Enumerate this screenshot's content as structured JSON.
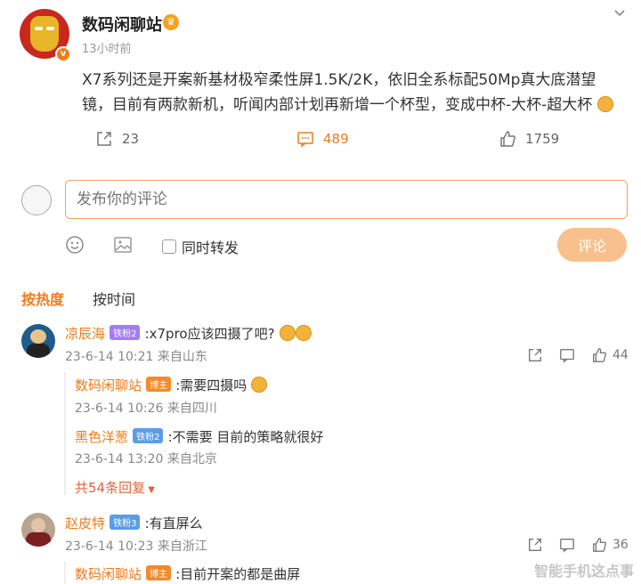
{
  "post": {
    "author": "数码闲聊站",
    "time": "13小时前",
    "text": "X7系列还是开案新基材极窄柔性屏1.5K/2K，依旧全系标配50Mp真大底潜望镜，目前有两款新机，听闻内部计划再新增一个杯型，变成中杯-大杯-超大杯",
    "verify_mark": "v",
    "shares": "23",
    "comments": "489",
    "likes": "1759"
  },
  "composer": {
    "placeholder": "发布你的评论",
    "repost_label": "同时转发",
    "submit_label": "评论"
  },
  "sort": {
    "hot": "按热度",
    "time": "按时间"
  },
  "comments": [
    {
      "user": "凉辰海",
      "badge": "铁粉2",
      "text": ":x7pro应该四摄了吧?",
      "date": "23-6-14 10:21",
      "source": "来自山东",
      "likes": "44",
      "replies": [
        {
          "user": "数码闲聊站",
          "badge": "博主",
          "text": ":需要四摄吗",
          "date": "23-6-14 10:26",
          "source": "来自四川"
        },
        {
          "user": "黑色洋葱",
          "badge": "铁粉2",
          "text": ":不需要 目前的策略就很好",
          "date": "23-6-14 13:20",
          "source": "来自北京"
        }
      ],
      "more": "共54条回复"
    },
    {
      "user": "赵皮特",
      "badge": "铁粉3",
      "text": ":有直屏么",
      "date": "23-6-14 10:23",
      "source": "来自浙江",
      "likes": "36",
      "replies": [
        {
          "user": "数码闲聊站",
          "badge": "博主",
          "text": ":目前开案的都是曲屏"
        }
      ]
    }
  ],
  "watermark": "智能手机这点事",
  "colors": {
    "accent": "#f07b1a",
    "button_disabled": "#f8c08c"
  }
}
